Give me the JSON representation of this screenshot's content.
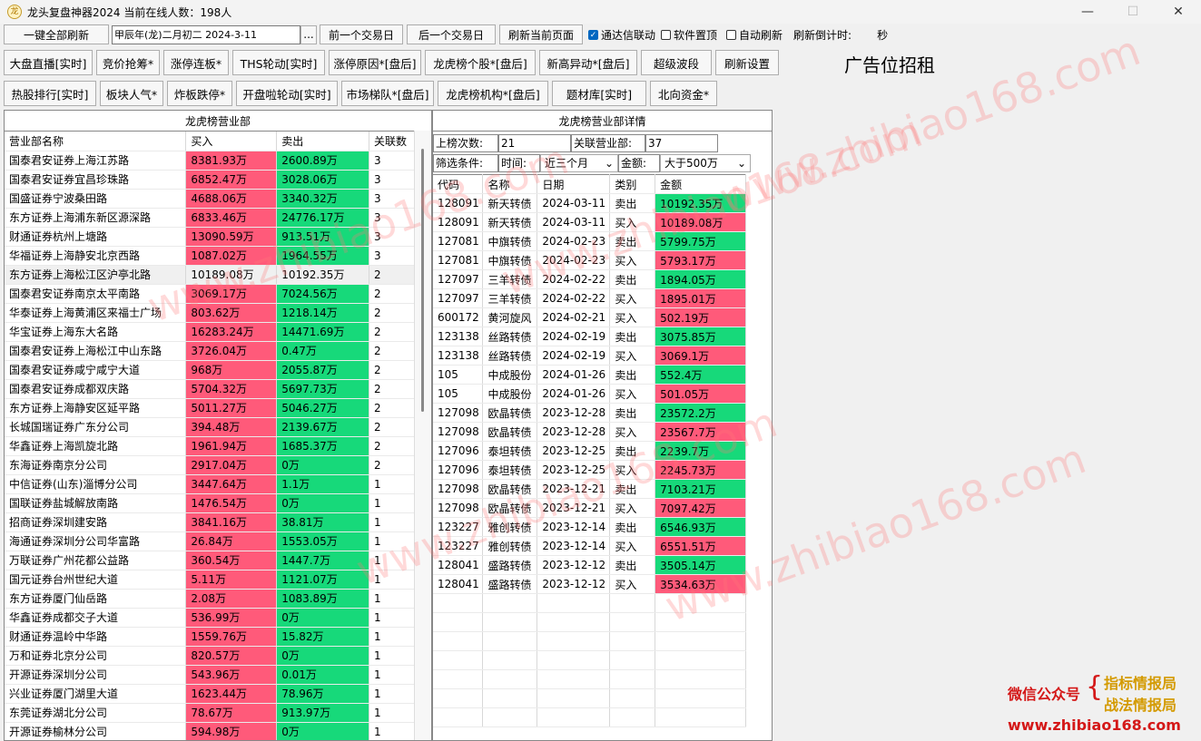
{
  "window": {
    "title": "龙头复盘神器2024 当前在线人数：198人",
    "min": "—",
    "max": "☐",
    "close": "✕"
  },
  "toolbar": {
    "refresh_all": "一键全部刷新",
    "date_value": "甲辰年(龙)二月初二  2024-3-11",
    "dots": "...",
    "prev_day": "前一个交易日",
    "next_day": "后一个交易日",
    "refresh_page": "刷新当前页面",
    "tdx_link": "通达信联动",
    "top_most": "软件置顶",
    "auto_refresh": "自动刷新",
    "countdown_label": "刷新倒计时:",
    "countdown_unit": "秒"
  },
  "nav_row1": [
    "大盘直播[实时]",
    "竞价抢筹*",
    "涨停连板*",
    "THS轮动[实时]",
    "涨停原因*[盘后]",
    "龙虎榜个股*[盘后]",
    "新高异动*[盘后]",
    "超级波段",
    "刷新设置"
  ],
  "nav_row2": [
    "热股排行[实时]",
    "板块人气*",
    "炸板跌停*",
    "开盘啦轮动[实时]",
    "市场梯队*[盘后]",
    "龙虎榜机构*[盘后]",
    "题材库[实时]",
    "北向资金*"
  ],
  "ad_text": "广告位招租",
  "left": {
    "title": "龙虎榜营业部",
    "headers": [
      "营业部名称",
      "买入",
      "卖出",
      "关联数"
    ],
    "rows": [
      [
        "国泰君安证券上海江苏路",
        "8381.93万",
        "2600.89万",
        "3"
      ],
      [
        "国泰君安证券宜昌珍珠路",
        "6852.47万",
        "3028.06万",
        "3"
      ],
      [
        "国盛证券宁波桑田路",
        "4688.06万",
        "3340.32万",
        "3"
      ],
      [
        "东方证券上海浦东新区源深路",
        "6833.46万",
        "24776.17万",
        "3"
      ],
      [
        "财通证券杭州上塘路",
        "13090.59万",
        "913.51万",
        "3"
      ],
      [
        "华福证券上海静安北京西路",
        "1087.02万",
        "1964.55万",
        "3"
      ],
      [
        "东方证券上海松江区沪亭北路",
        "10189.08万",
        "10192.35万",
        "2"
      ],
      [
        "国泰君安证券南京太平南路",
        "3069.17万",
        "7024.56万",
        "2"
      ],
      [
        "华泰证券上海黄浦区来福士广场",
        "803.62万",
        "1218.14万",
        "2"
      ],
      [
        "华宝证券上海东大名路",
        "16283.24万",
        "14471.69万",
        "2"
      ],
      [
        "国泰君安证券上海松江中山东路",
        "3726.04万",
        "0.47万",
        "2"
      ],
      [
        "国泰君安证券咸宁咸宁大道",
        "968万",
        "2055.87万",
        "2"
      ],
      [
        "国泰君安证券成都双庆路",
        "5704.32万",
        "5697.73万",
        "2"
      ],
      [
        "东方证券上海静安区延平路",
        "5011.27万",
        "5046.27万",
        "2"
      ],
      [
        "长城国瑞证券广东分公司",
        "394.48万",
        "2139.67万",
        "2"
      ],
      [
        "华鑫证券上海凯旋北路",
        "1961.94万",
        "1685.37万",
        "2"
      ],
      [
        "东海证券南京分公司",
        "2917.04万",
        "0万",
        "2"
      ],
      [
        "中信证券(山东)淄博分公司",
        "3447.64万",
        "1.1万",
        "1"
      ],
      [
        "国联证券盐城解放南路",
        "1476.54万",
        "0万",
        "1"
      ],
      [
        "招商证券深圳建安路",
        "3841.16万",
        "38.81万",
        "1"
      ],
      [
        "海通证券深圳分公司华富路",
        "26.84万",
        "1553.05万",
        "1"
      ],
      [
        "万联证券广州花都公益路",
        "360.54万",
        "1447.7万",
        "1"
      ],
      [
        "国元证券台州世纪大道",
        "5.11万",
        "1121.07万",
        "1"
      ],
      [
        "东方证券厦门仙岳路",
        "2.08万",
        "1083.89万",
        "1"
      ],
      [
        "华鑫证券成都交子大道",
        "536.99万",
        "0万",
        "1"
      ],
      [
        "财通证券温岭中华路",
        "1559.76万",
        "15.82万",
        "1"
      ],
      [
        "万和证券北京分公司",
        "820.57万",
        "0万",
        "1"
      ],
      [
        "开源证券深圳分公司",
        "543.96万",
        "0.01万",
        "1"
      ],
      [
        "兴业证券厦门湖里大道",
        "1623.44万",
        "78.96万",
        "1"
      ],
      [
        "东莞证券湖北分公司",
        "78.67万",
        "913.97万",
        "1"
      ],
      [
        "开源证券榆林分公司",
        "594.98万",
        "0万",
        "1"
      ]
    ]
  },
  "right": {
    "title": "龙虎榜营业部详情",
    "count_label": "上榜次数:",
    "count_value": "21",
    "related_label": "关联营业部:",
    "related_value": "37",
    "filter_label": "筛选条件:",
    "time_label": "时间:",
    "time_value": "近三个月",
    "amount_label": "金额:",
    "amount_value": "大于500万",
    "headers": [
      "代码",
      "名称",
      "日期",
      "类别",
      "金额"
    ],
    "rows": [
      [
        "128091",
        "新天转债",
        "2024-03-11",
        "卖出",
        "10192.35万"
      ],
      [
        "128091",
        "新天转债",
        "2024-03-11",
        "买入",
        "10189.08万"
      ],
      [
        "127081",
        "中旗转债",
        "2024-02-23",
        "卖出",
        "5799.75万"
      ],
      [
        "127081",
        "中旗转债",
        "2024-02-23",
        "买入",
        "5793.17万"
      ],
      [
        "127097",
        "三羊转债",
        "2024-02-22",
        "卖出",
        "1894.05万"
      ],
      [
        "127097",
        "三羊转债",
        "2024-02-22",
        "买入",
        "1895.01万"
      ],
      [
        "600172",
        "黄河旋风",
        "2024-02-21",
        "买入",
        "502.19万"
      ],
      [
        "123138",
        "丝路转债",
        "2024-02-19",
        "卖出",
        "3075.85万"
      ],
      [
        "123138",
        "丝路转债",
        "2024-02-19",
        "买入",
        "3069.1万"
      ],
      [
        "105",
        "中成股份",
        "2024-01-26",
        "卖出",
        "552.4万"
      ],
      [
        "105",
        "中成股份",
        "2024-01-26",
        "买入",
        "501.05万"
      ],
      [
        "127098",
        "欧晶转债",
        "2023-12-28",
        "卖出",
        "23572.2万"
      ],
      [
        "127098",
        "欧晶转债",
        "2023-12-28",
        "买入",
        "23567.7万"
      ],
      [
        "127096",
        "泰坦转债",
        "2023-12-25",
        "卖出",
        "2239.7万"
      ],
      [
        "127096",
        "泰坦转债",
        "2023-12-25",
        "买入",
        "2245.73万"
      ],
      [
        "127098",
        "欧晶转债",
        "2023-12-21",
        "卖出",
        "7103.21万"
      ],
      [
        "127098",
        "欧晶转债",
        "2023-12-21",
        "买入",
        "7097.42万"
      ],
      [
        "123227",
        "雅创转债",
        "2023-12-14",
        "卖出",
        "6546.93万"
      ],
      [
        "123227",
        "雅创转债",
        "2023-12-14",
        "买入",
        "6551.51万"
      ],
      [
        "128041",
        "盛路转债",
        "2023-12-12",
        "卖出",
        "3505.14万"
      ],
      [
        "128041",
        "盛路转债",
        "2023-12-12",
        "买入",
        "3534.63万"
      ]
    ]
  },
  "watermark": "www.zhibiao168.com",
  "promo": {
    "wechat": "微信公众号",
    "line1": "指标情报局",
    "line2": "战法情报局",
    "url": "www.zhibiao168.com"
  },
  "colors": {
    "buy": "#ff5a7a",
    "sell": "#17d97a"
  }
}
